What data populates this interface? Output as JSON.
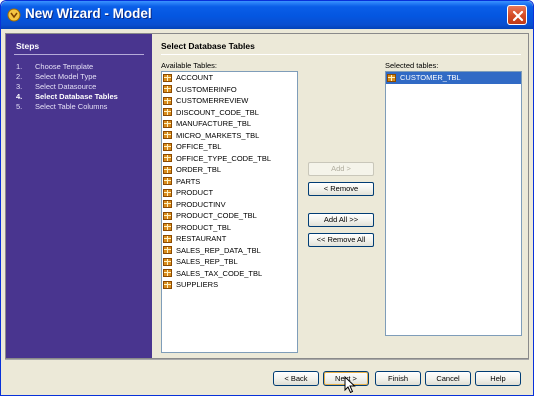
{
  "window": {
    "title": "New Wizard - Model",
    "app_icon": "wizard-icon",
    "close_icon": "close-icon"
  },
  "steps": {
    "title": "Steps",
    "items": [
      {
        "num": "1.",
        "label": "Choose Template",
        "active": false
      },
      {
        "num": "2.",
        "label": "Select Model Type",
        "active": false
      },
      {
        "num": "3.",
        "label": "Select Datasource",
        "active": false
      },
      {
        "num": "4.",
        "label": "Select Database Tables",
        "active": true
      },
      {
        "num": "5.",
        "label": "Select Table Columns",
        "active": false
      }
    ]
  },
  "main": {
    "section_title": "Select Database Tables",
    "available_label": "Available Tables:",
    "selected_label": "Selected tables:",
    "table_icon": "database-table-icon",
    "available_tables": [
      "ACCOUNT",
      "CUSTOMERINFO",
      "CUSTOMERREVIEW",
      "DISCOUNT_CODE_TBL",
      "MANUFACTURE_TBL",
      "MICRO_MARKETS_TBL",
      "OFFICE_TBL",
      "OFFICE_TYPE_CODE_TBL",
      "ORDER_TBL",
      "PARTS",
      "PRODUCT",
      "PRODUCTINV",
      "PRODUCT_CODE_TBL",
      "PRODUCT_TBL",
      "RESTAURANT",
      "SALES_REP_DATA_TBL",
      "SALES_REP_TBL",
      "SALES_TAX_CODE_TBL",
      "SUPPLIERS"
    ],
    "selected_tables": [
      "CUSTOMER_TBL"
    ],
    "buttons": {
      "add": "Add >",
      "remove": "< Remove",
      "add_all": "Add All >>",
      "remove_all": "<< Remove All"
    }
  },
  "footer": {
    "back": "< Back",
    "next": "Next >",
    "finish": "Finish",
    "cancel": "Cancel",
    "help": "Help"
  },
  "colors": {
    "titlebar": "#0456e0",
    "steps_panel": "#49358f",
    "selection": "#316ac5",
    "dialog_bg": "#ece9d8"
  }
}
